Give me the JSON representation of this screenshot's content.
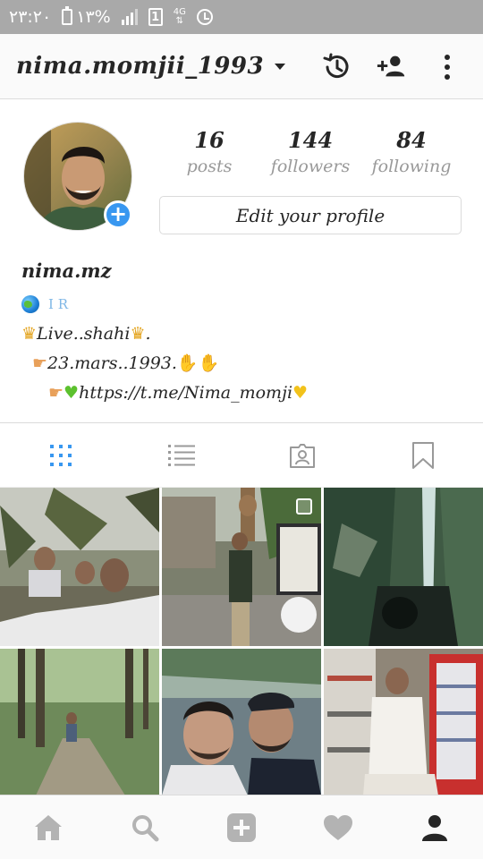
{
  "status_bar": {
    "time": "۲۳:۲۰",
    "battery_percent": "۱۳%",
    "sim_slot": "1",
    "network": "4G"
  },
  "top_bar": {
    "username": "nima.momjii_1993",
    "icons": [
      "history-icon",
      "add-person-icon",
      "more-options-icon"
    ]
  },
  "profile": {
    "stats": [
      {
        "value": "16",
        "label": "posts"
      },
      {
        "value": "144",
        "label": "followers"
      },
      {
        "value": "84",
        "label": "following"
      }
    ],
    "edit_label": "Edit your profile",
    "display_name": "nima.mz",
    "bio": {
      "line1": "I R",
      "line2": "Live..shahi",
      "line3": "23.mars..1993.",
      "line4": "https://t.me/Nima_momji"
    }
  },
  "tabs": [
    "grid-view",
    "list-view",
    "tagged",
    "saved"
  ],
  "accent_color": "#3897f0",
  "bottom_nav": [
    "home",
    "search",
    "new-post",
    "activity",
    "profile"
  ]
}
